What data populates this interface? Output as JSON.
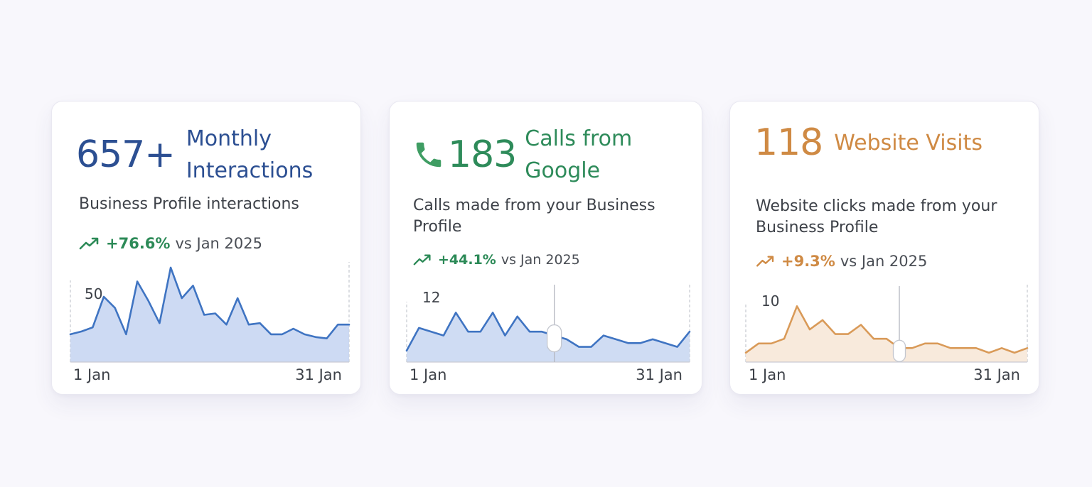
{
  "cards": [
    {
      "number": "657+",
      "label_line1": "Monthly",
      "label_line2": "Interactions",
      "desc_line1": "Business Profile interactions",
      "desc_line2": "",
      "trend_pct": "+76.6%",
      "trend_rest": "vs Jan 2025",
      "accent": "#2c4f92",
      "trend_color": "#2c8a57",
      "icon": "trend-up-icon"
    },
    {
      "number": "183",
      "label_line1": "Calls from",
      "label_line2": "Google",
      "desc_line1": "Calls made from your Business",
      "desc_line2": "Profile",
      "trend_pct": "+44.1%",
      "trend_rest": "vs Jan 2025",
      "accent": "#2e8b5a",
      "trend_color": "#2c8a57",
      "icon": "phone-icon"
    },
    {
      "number": "118",
      "label_line1": "Website Visits",
      "label_line2": "",
      "desc_line1": "Website clicks made from your",
      "desc_line2": "Business Profile",
      "trend_pct": "+9.3%",
      "trend_rest": "vs Jan 2025",
      "accent": "#cf8a44",
      "trend_color": "#cf8a44",
      "icon": "trend-up-icon"
    }
  ],
  "chart_data": [
    {
      "type": "area",
      "x_start_label": "1 Jan",
      "x_end_label": "31 Jan",
      "y_tick_label": "50",
      "y_tick_value": 50,
      "ylim": [
        0,
        70
      ],
      "line_color": "#3f74c2",
      "fill_color": "#c4d4f1",
      "values": [
        20,
        22,
        25,
        47,
        39,
        20,
        58,
        44,
        28,
        68,
        46,
        55,
        34,
        35,
        27,
        46,
        27,
        28,
        20,
        20,
        24,
        20,
        18,
        17,
        27,
        27
      ],
      "marker_index": null
    },
    {
      "type": "area",
      "x_start_label": "1 Jan",
      "x_end_label": "31 Jan",
      "y_tick_label": "12",
      "y_tick_value": 12,
      "ylim": [
        0,
        20
      ],
      "line_color": "#3f74c2",
      "fill_color": "#c7d6f1",
      "values": [
        3,
        9,
        8,
        7,
        13,
        8,
        8,
        13,
        7,
        12,
        8,
        8,
        7,
        6,
        4,
        4,
        7,
        6,
        5,
        5,
        6,
        5,
        4,
        8
      ],
      "marker_index": 12
    },
    {
      "type": "area",
      "x_start_label": "1 Jan",
      "x_end_label": "31 Jan",
      "y_tick_label": "10",
      "y_tick_value": 10,
      "ylim": [
        0,
        16
      ],
      "line_color": "#d99a58",
      "fill_color": "#f7e6d6",
      "values": [
        2,
        4,
        4,
        5,
        12,
        7,
        9,
        6,
        6,
        8,
        5,
        5,
        3,
        3,
        4,
        4,
        3,
        3,
        3,
        2,
        3,
        2,
        3
      ],
      "marker_index": 12
    }
  ]
}
